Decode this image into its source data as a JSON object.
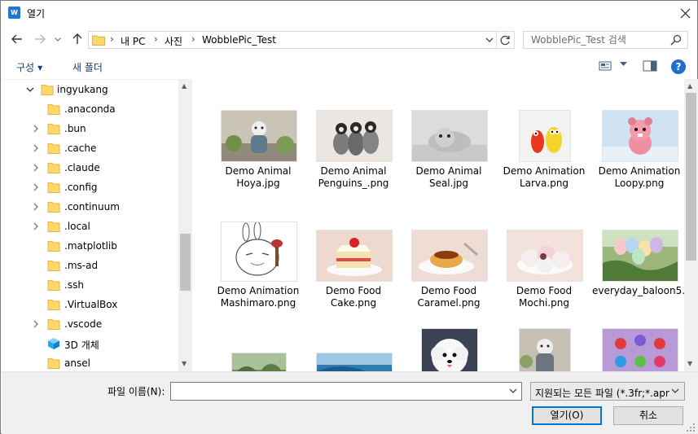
{
  "window": {
    "title": "열기",
    "accent": "#0078d7"
  },
  "address": {
    "breadcrumbs": [
      "내 PC",
      "사진",
      "WobblePic_Test"
    ]
  },
  "search": {
    "placeholder": "WobblePic_Test 검색"
  },
  "toolbar": {
    "organize": "구성",
    "new_folder": "새 폴더",
    "help": "?"
  },
  "tree": [
    {
      "label": "ingyukang",
      "icon": "folder-icon",
      "arrow": "expanded"
    },
    {
      "label": ".anaconda",
      "icon": "folder-icon",
      "arrow": "none"
    },
    {
      "label": ".bun",
      "icon": "folder-icon",
      "arrow": "collapsed"
    },
    {
      "label": ".cache",
      "icon": "folder-icon",
      "arrow": "collapsed"
    },
    {
      "label": ".claude",
      "icon": "folder-icon",
      "arrow": "collapsed"
    },
    {
      "label": ".config",
      "icon": "folder-icon",
      "arrow": "collapsed"
    },
    {
      "label": ".continuum",
      "icon": "folder-icon",
      "arrow": "collapsed"
    },
    {
      "label": ".local",
      "icon": "folder-icon",
      "arrow": "collapsed"
    },
    {
      "label": ".matplotlib",
      "icon": "folder-icon",
      "arrow": "none"
    },
    {
      "label": ".ms-ad",
      "icon": "folder-icon",
      "arrow": "none"
    },
    {
      "label": ".ssh",
      "icon": "folder-icon",
      "arrow": "none"
    },
    {
      "label": ".VirtualBox",
      "icon": "folder-icon",
      "arrow": "none"
    },
    {
      "label": ".vscode",
      "icon": "folder-icon",
      "arrow": "collapsed"
    },
    {
      "label": "3D 개체",
      "icon": "3d-objects-icon",
      "arrow": "none"
    },
    {
      "label": "ansel",
      "icon": "folder-icon",
      "arrow": "none"
    }
  ],
  "files": [
    {
      "label": "Demo Animal Hoya.jpg"
    },
    {
      "label": "Demo Animal Penguins_.png"
    },
    {
      "label": "Demo Animal Seal.jpg"
    },
    {
      "label": "Demo Animation Larva.png"
    },
    {
      "label": "Demo Animation Loopy.png"
    },
    {
      "label": "Demo Animation Mashimaro.png"
    },
    {
      "label": "Demo Food Cake.png"
    },
    {
      "label": "Demo Food Caramel.png"
    },
    {
      "label": "Demo Food Mochi.png"
    },
    {
      "label": "everyday_baloon5.png"
    },
    {
      "label": ""
    },
    {
      "label": ""
    },
    {
      "label": ""
    },
    {
      "label": ""
    },
    {
      "label": ""
    }
  ],
  "file_name": {
    "label": "파일 이름(N):",
    "value": ""
  },
  "file_type": {
    "selected": "지원되는 모든 파일 (*.3fr;*.apr"
  },
  "buttons": {
    "open": "열기(O)",
    "cancel": "취소"
  }
}
